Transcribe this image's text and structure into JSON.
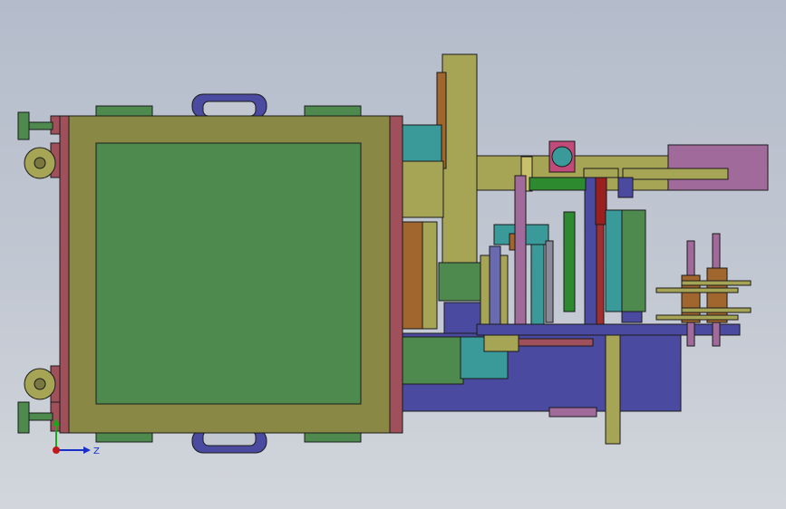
{
  "viewport": {
    "background_top": "#b4bccb",
    "background_bottom": "#d2d6dc"
  },
  "triad": {
    "z_label": "Z",
    "x_color": "#c01818",
    "y_color": "#18a818",
    "z_color": "#1830c8"
  },
  "palette": {
    "frame": "#8a8845",
    "panel": "#4e8a4e",
    "flange": "#a0505a",
    "purple": "#4a4aa0",
    "teal": "#3a9a9a",
    "olive": "#a6a455",
    "mauve": "#a06a9a",
    "dark_red": "#9a1f1f",
    "brown": "#a0662e"
  }
}
